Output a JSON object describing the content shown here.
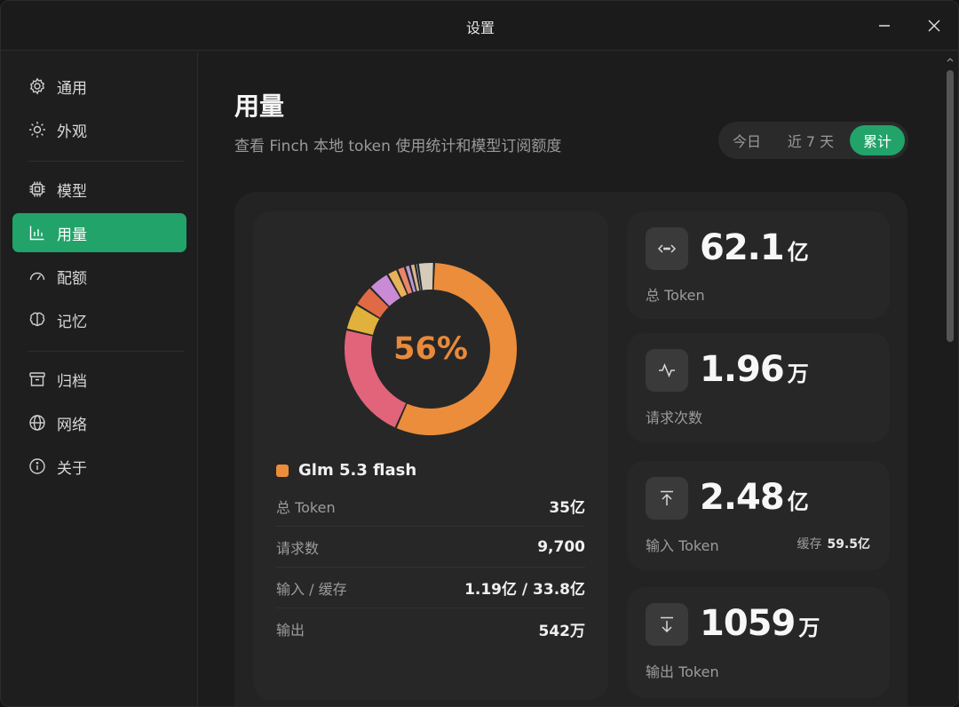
{
  "window": {
    "title": "设置"
  },
  "sidebar": {
    "items": [
      {
        "label": "通用",
        "icon": "gear-icon"
      },
      {
        "label": "外观",
        "icon": "sun-icon"
      },
      {
        "label": "模型",
        "icon": "chip-icon"
      },
      {
        "label": "用量",
        "icon": "bar-chart-icon",
        "active": true
      },
      {
        "label": "配额",
        "icon": "gauge-icon"
      },
      {
        "label": "记忆",
        "icon": "brain-icon"
      },
      {
        "label": "归档",
        "icon": "archive-icon"
      },
      {
        "label": "网络",
        "icon": "globe-icon"
      },
      {
        "label": "关于",
        "icon": "info-icon"
      }
    ]
  },
  "page": {
    "title": "用量",
    "subtitle": "查看 Finch 本地 token 使用统计和模型订阅额度"
  },
  "range": {
    "options": [
      "今日",
      "近 7 天",
      "累计"
    ],
    "selected": "累计"
  },
  "model_card": {
    "percent": "56%",
    "model_name": "Glm 5.3 flash",
    "model_color": "#ec8d3b",
    "rows": [
      {
        "label": "总 Token",
        "value": "35亿"
      },
      {
        "label": "请求数",
        "value": "9,700"
      },
      {
        "label": "输入 / 缓存",
        "value": "1.19亿 / 33.8亿"
      },
      {
        "label": "输出",
        "value": "542万"
      }
    ]
  },
  "chart_data": {
    "type": "pie",
    "donut": true,
    "center_label": "56%",
    "slices": [
      {
        "value": 56,
        "color": "#ec8d3b"
      },
      {
        "value": 22,
        "color": "#e2647a"
      },
      {
        "value": 5,
        "color": "#e0b13b"
      },
      {
        "value": 4,
        "color": "#e06a45"
      },
      {
        "value": 4,
        "color": "#c98bd6"
      },
      {
        "value": 2,
        "color": "#e8b25a"
      },
      {
        "value": 1.5,
        "color": "#e8856a"
      },
      {
        "value": 1,
        "color": "#b89ad8"
      },
      {
        "value": 1,
        "color": "#d9b48a"
      },
      {
        "value": 0.5,
        "color": "#8ec6e0"
      },
      {
        "value": 3,
        "color": "#d6cbb8"
      }
    ]
  },
  "kpis": [
    {
      "number": "62.1",
      "unit": "亿",
      "caption": "总 Token",
      "icon": "code-arrows-icon"
    },
    {
      "number": "1.96",
      "unit": "万",
      "caption": "请求次数",
      "icon": "activity-icon"
    },
    {
      "number": "2.48",
      "unit": "亿",
      "caption": "输入 Token",
      "icon": "arrow-up-icon",
      "extra_label": "缓存",
      "extra_value": "59.5亿"
    },
    {
      "number": "1059",
      "unit": "万",
      "caption": "输出 Token",
      "icon": "arrow-down-icon"
    }
  ],
  "colors": {
    "accent": "#22a36a",
    "panel": "#272727",
    "background": "#1c1c1c"
  }
}
